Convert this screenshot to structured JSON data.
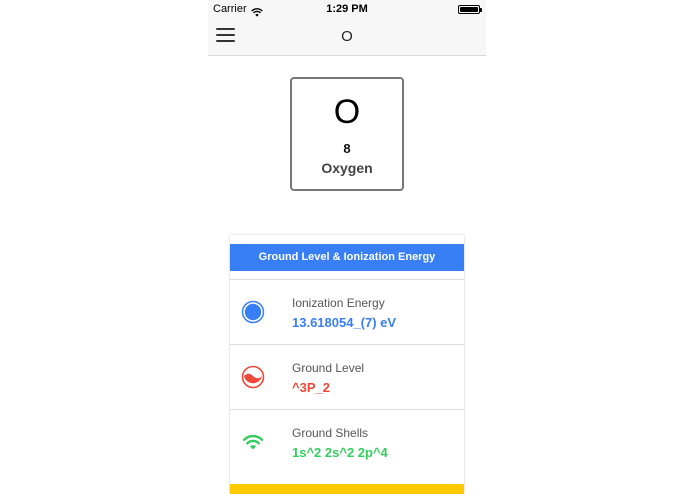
{
  "status_bar": {
    "carrier": "Carrier",
    "time": "1:29 PM"
  },
  "nav": {
    "title": "O",
    "menu_icon": "hamburger-icon"
  },
  "element": {
    "symbol": "O",
    "number": "8",
    "name": "Oxygen"
  },
  "card": {
    "header": "Ground Level & Ionization Energy",
    "rows": [
      {
        "label": "Ionization Energy",
        "value": "13.618054_(7) eV",
        "color": "#387ef5",
        "icon": "circle-icon"
      },
      {
        "label": "Ground Level",
        "value": "^3P_2",
        "color": "#ef473a",
        "icon": "wave-circle-icon"
      },
      {
        "label": "Ground Shells",
        "value": "1s^2 2s^2 2p^4",
        "color": "#33cd5f",
        "icon": "wifi-icon"
      }
    ]
  },
  "colors": {
    "header_blue": "#387ef5",
    "footer_yellow": "#ffc900"
  }
}
